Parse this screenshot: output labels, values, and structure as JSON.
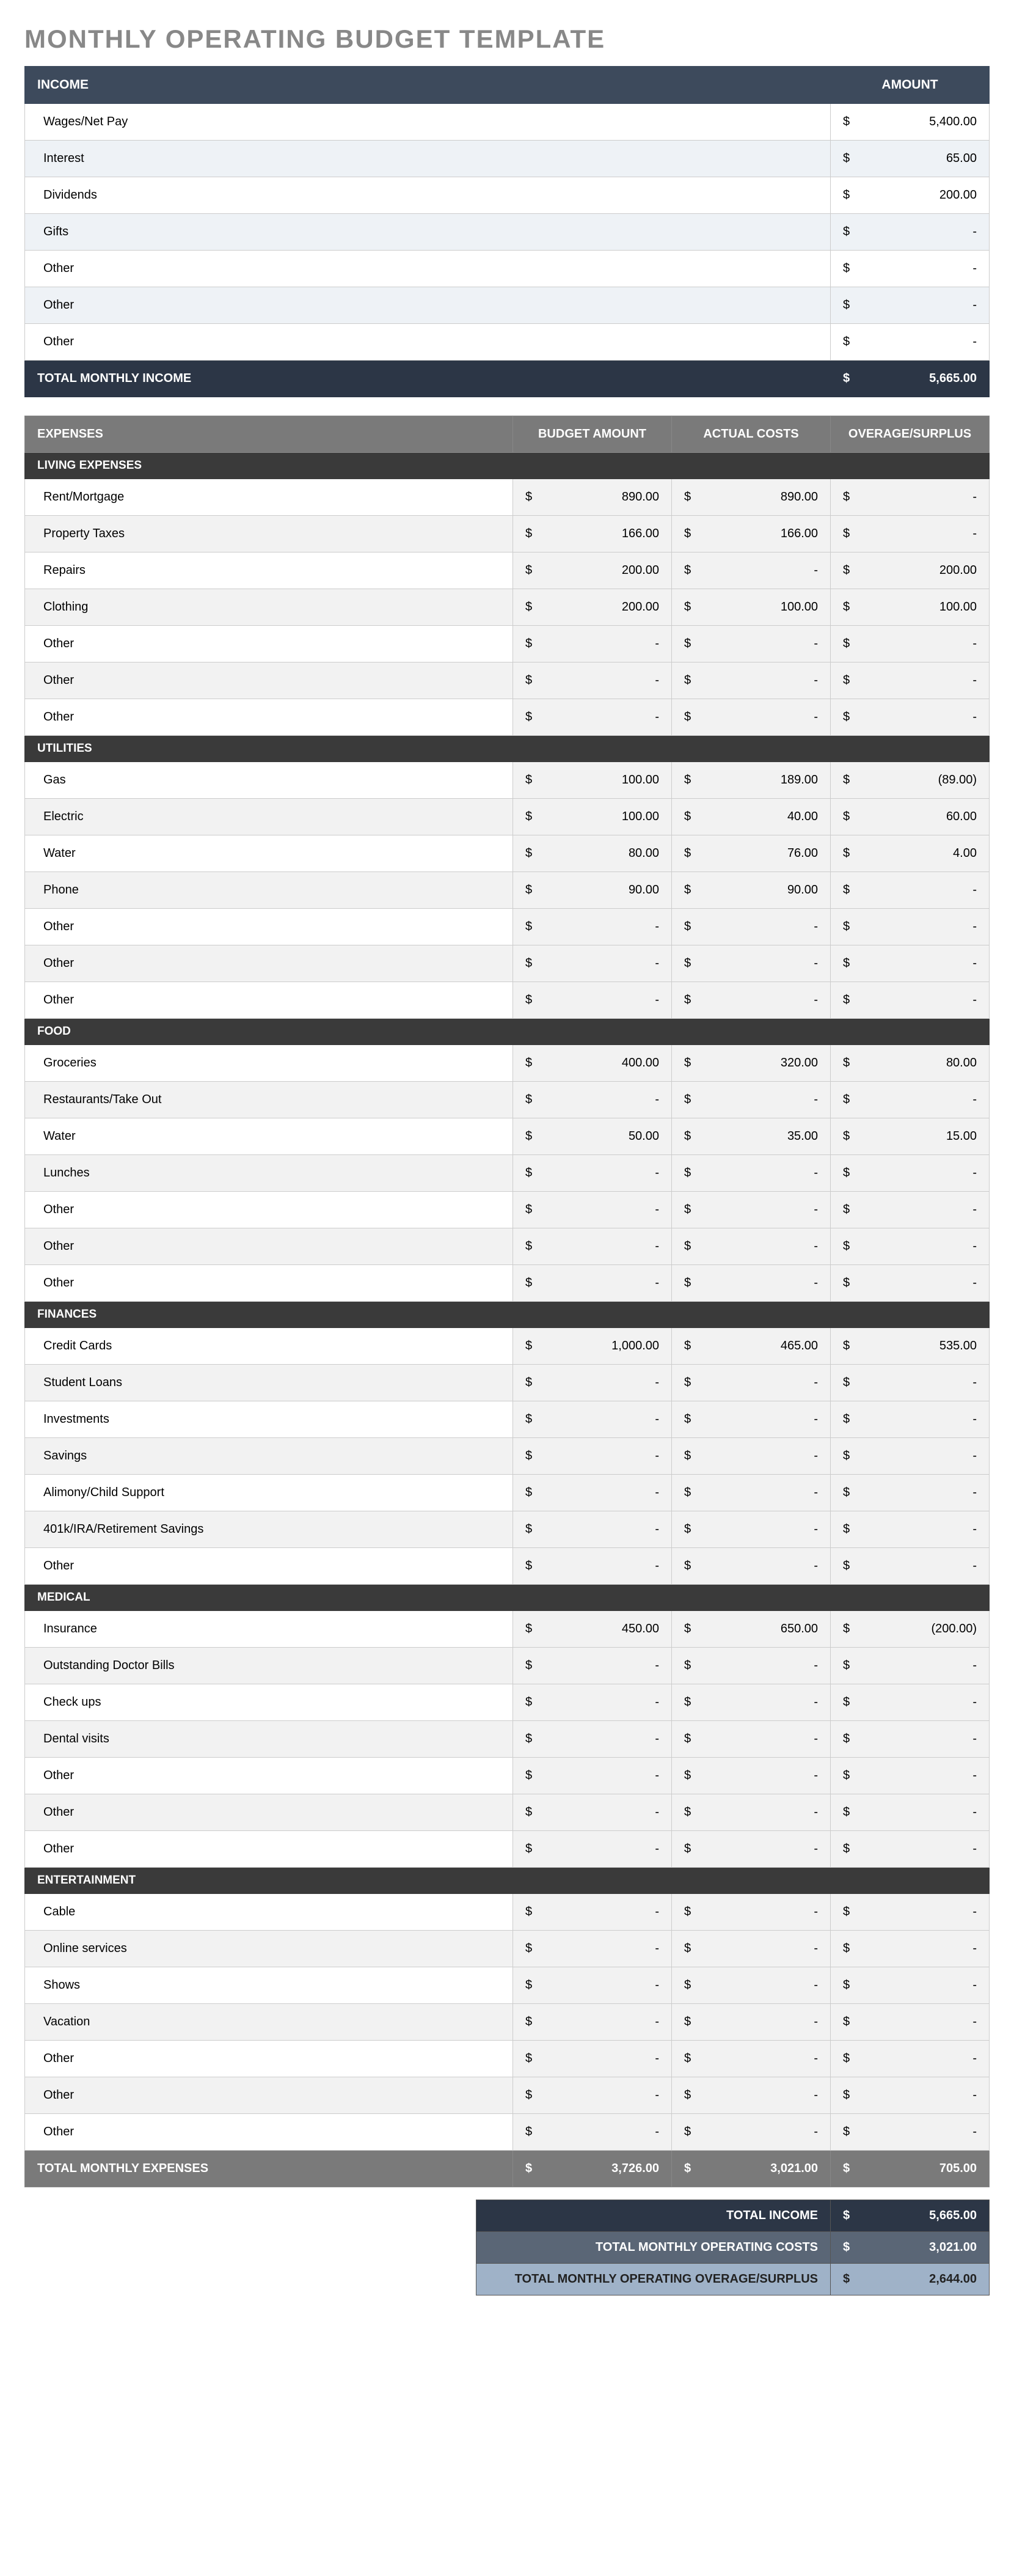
{
  "title": "MONTHLY OPERATING BUDGET TEMPLATE",
  "income": {
    "header_label": "INCOME",
    "amount_label": "AMOUNT",
    "rows": [
      {
        "label": "Wages/Net Pay",
        "amount": "5,400.00"
      },
      {
        "label": "Interest",
        "amount": "65.00"
      },
      {
        "label": "Dividends",
        "amount": "200.00"
      },
      {
        "label": "Gifts",
        "amount": "-"
      },
      {
        "label": "Other",
        "amount": "-"
      },
      {
        "label": "Other",
        "amount": "-"
      },
      {
        "label": "Other",
        "amount": "-"
      }
    ],
    "total_label": "TOTAL MONTHLY INCOME",
    "total_amount": "5,665.00"
  },
  "expenses": {
    "header_label": "EXPENSES",
    "col_budget": "BUDGET AMOUNT",
    "col_actual": "ACTUAL COSTS",
    "col_overage": "OVERAGE/SURPLUS",
    "sections": [
      {
        "name": "LIVING EXPENSES",
        "rows": [
          {
            "label": "Rent/Mortgage",
            "budget": "890.00",
            "actual": "890.00",
            "overage": "-"
          },
          {
            "label": "Property Taxes",
            "budget": "166.00",
            "actual": "166.00",
            "overage": "-"
          },
          {
            "label": "Repairs",
            "budget": "200.00",
            "actual": "-",
            "overage": "200.00"
          },
          {
            "label": "Clothing",
            "budget": "200.00",
            "actual": "100.00",
            "overage": "100.00"
          },
          {
            "label": "Other",
            "budget": "-",
            "actual": "-",
            "overage": "-"
          },
          {
            "label": "Other",
            "budget": "-",
            "actual": "-",
            "overage": "-"
          },
          {
            "label": "Other",
            "budget": "-",
            "actual": "-",
            "overage": "-"
          }
        ]
      },
      {
        "name": "UTILITIES",
        "rows": [
          {
            "label": "Gas",
            "budget": "100.00",
            "actual": "189.00",
            "overage": "(89.00)"
          },
          {
            "label": "Electric",
            "budget": "100.00",
            "actual": "40.00",
            "overage": "60.00"
          },
          {
            "label": "Water",
            "budget": "80.00",
            "actual": "76.00",
            "overage": "4.00"
          },
          {
            "label": "Phone",
            "budget": "90.00",
            "actual": "90.00",
            "overage": "-"
          },
          {
            "label": "Other",
            "budget": "-",
            "actual": "-",
            "overage": "-"
          },
          {
            "label": "Other",
            "budget": "-",
            "actual": "-",
            "overage": "-"
          },
          {
            "label": "Other",
            "budget": "-",
            "actual": "-",
            "overage": "-"
          }
        ]
      },
      {
        "name": "FOOD",
        "rows": [
          {
            "label": "Groceries",
            "budget": "400.00",
            "actual": "320.00",
            "overage": "80.00"
          },
          {
            "label": "Restaurants/Take Out",
            "budget": "-",
            "actual": "-",
            "overage": "-"
          },
          {
            "label": "Water",
            "budget": "50.00",
            "actual": "35.00",
            "overage": "15.00"
          },
          {
            "label": "Lunches",
            "budget": "-",
            "actual": "-",
            "overage": "-"
          },
          {
            "label": "Other",
            "budget": "-",
            "actual": "-",
            "overage": "-"
          },
          {
            "label": "Other",
            "budget": "-",
            "actual": "-",
            "overage": "-"
          },
          {
            "label": "Other",
            "budget": "-",
            "actual": "-",
            "overage": "-"
          }
        ]
      },
      {
        "name": "FINANCES",
        "rows": [
          {
            "label": "Credit Cards",
            "budget": "1,000.00",
            "actual": "465.00",
            "overage": "535.00"
          },
          {
            "label": "Student Loans",
            "budget": "-",
            "actual": "-",
            "overage": "-"
          },
          {
            "label": "Investments",
            "budget": "-",
            "actual": "-",
            "overage": "-"
          },
          {
            "label": "Savings",
            "budget": "-",
            "actual": "-",
            "overage": "-"
          },
          {
            "label": "Alimony/Child Support",
            "budget": "-",
            "actual": "-",
            "overage": "-"
          },
          {
            "label": "401k/IRA/Retirement Savings",
            "budget": "-",
            "actual": "-",
            "overage": "-"
          },
          {
            "label": "Other",
            "budget": "-",
            "actual": "-",
            "overage": "-"
          }
        ]
      },
      {
        "name": "MEDICAL",
        "rows": [
          {
            "label": "Insurance",
            "budget": "450.00",
            "actual": "650.00",
            "overage": "(200.00)"
          },
          {
            "label": "Outstanding Doctor Bills",
            "budget": "-",
            "actual": "-",
            "overage": "-"
          },
          {
            "label": "Check ups",
            "budget": "-",
            "actual": "-",
            "overage": "-"
          },
          {
            "label": "Dental visits",
            "budget": "-",
            "actual": "-",
            "overage": "-"
          },
          {
            "label": "Other",
            "budget": "-",
            "actual": "-",
            "overage": "-"
          },
          {
            "label": "Other",
            "budget": "-",
            "actual": "-",
            "overage": "-"
          },
          {
            "label": "Other",
            "budget": "-",
            "actual": "-",
            "overage": "-"
          }
        ]
      },
      {
        "name": "ENTERTAINMENT",
        "rows": [
          {
            "label": "Cable",
            "budget": "-",
            "actual": "-",
            "overage": "-"
          },
          {
            "label": "Online services",
            "budget": "-",
            "actual": "-",
            "overage": "-"
          },
          {
            "label": "Shows",
            "budget": "-",
            "actual": "-",
            "overage": "-"
          },
          {
            "label": "Vacation",
            "budget": "-",
            "actual": "-",
            "overage": "-"
          },
          {
            "label": "Other",
            "budget": "-",
            "actual": "-",
            "overage": "-"
          },
          {
            "label": "Other",
            "budget": "-",
            "actual": "-",
            "overage": "-"
          },
          {
            "label": "Other",
            "budget": "-",
            "actual": "-",
            "overage": "-"
          }
        ]
      }
    ],
    "total_label": "TOTAL MONTHLY EXPENSES",
    "total_budget": "3,726.00",
    "total_actual": "3,021.00",
    "total_overage": "705.00"
  },
  "summary": {
    "rows": [
      {
        "label": "TOTAL INCOME",
        "amount": "5,665.00"
      },
      {
        "label": "TOTAL MONTHLY OPERATING COSTS",
        "amount": "3,021.00"
      },
      {
        "label": "TOTAL MONTHLY OPERATING OVERAGE/SURPLUS",
        "amount": "2,644.00"
      }
    ]
  }
}
